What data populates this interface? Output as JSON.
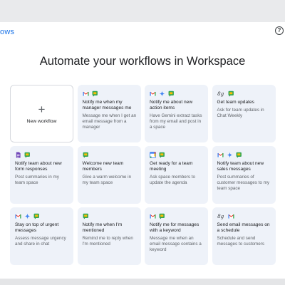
{
  "app": {
    "brand_fragment": "ows",
    "help_icon": "question-mark-icon"
  },
  "headline": "Automate your workflows in Workspace",
  "new_workflow": {
    "plus": "+",
    "label": "New workflow"
  },
  "colors": {
    "brand": "#1a73e8",
    "card_bg": "#eef2f9",
    "gmail_red": "#ea4335",
    "chat_green": "#34a853",
    "gemini_blue": "#4285f4"
  },
  "cards": [
    {
      "icons": [
        "gmail-icon",
        "chat-icon"
      ],
      "title": "Notify me when my manager messages me",
      "desc": "Message me when I get an email message from a manager"
    },
    {
      "icons": [
        "gmail-icon",
        "gemini-icon",
        "chat-icon"
      ],
      "title": "Notify me about new action items",
      "desc": "Have Gemini extract tasks from my email and post in a space"
    },
    {
      "icons": [
        "schedule-icon",
        "chat-icon"
      ],
      "title": "Get team updates",
      "desc": "Ask for team updates in Chat Weekly"
    },
    {
      "icons": [
        "forms-icon",
        "chat-icon"
      ],
      "title": "Notify team about new form responses",
      "desc": "Post summaries in my team space"
    },
    {
      "icons": [
        "chat-icon"
      ],
      "title": "Welcome new team members",
      "desc": "Give a warm welcome in my team space"
    },
    {
      "icons": [
        "calendar-icon",
        "chat-icon"
      ],
      "title": "Get ready for a team meeting",
      "desc": "Ask space members to update the agenda"
    },
    {
      "icons": [
        "gmail-icon",
        "gemini-icon",
        "chat-icon"
      ],
      "title": "Notify team about new sales messages",
      "desc": "Post summaries of customer messages to my team space"
    },
    {
      "icons": [
        "gmail-icon",
        "gemini-icon",
        "chat-icon"
      ],
      "title": "Stay on top of urgent messages",
      "desc": "Assess message urgency and share in chat"
    },
    {
      "icons": [
        "chat-icon"
      ],
      "title": "Notify me when I'm mentioned",
      "desc": "Remind me to reply when I'm mentioned"
    },
    {
      "icons": [
        "gmail-icon",
        "chat-icon"
      ],
      "title": "Notify me for messages with a keyword",
      "desc": "Message me when an email message contains a keyword"
    },
    {
      "icons": [
        "schedule-icon",
        "gmail-icon"
      ],
      "title": "Send email messages on a schedule",
      "desc": "Schedule and send messages to customers"
    }
  ]
}
